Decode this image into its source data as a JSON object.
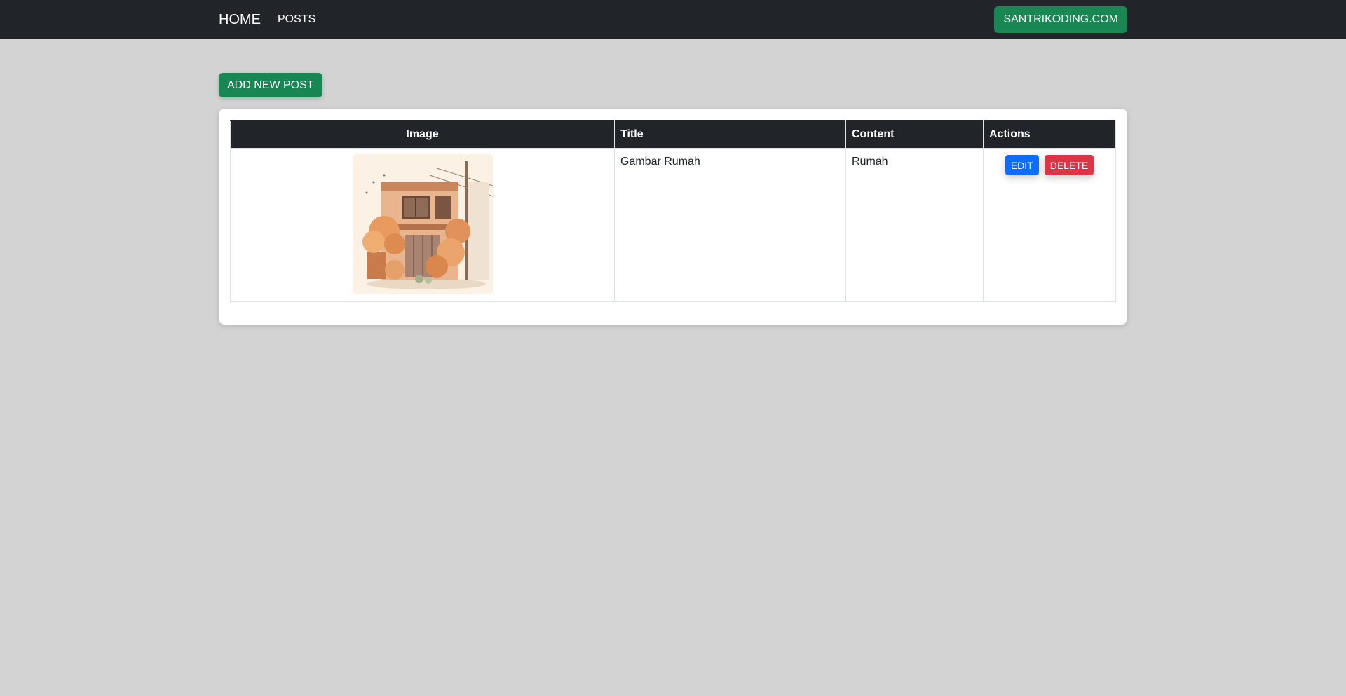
{
  "navbar": {
    "brand": "HOME",
    "links": [
      {
        "label": "POSTS"
      }
    ],
    "site_button": "SANTRIKODING.COM"
  },
  "main": {
    "add_button": "ADD NEW POST",
    "table": {
      "headers": [
        "Image",
        "Title",
        "Content",
        "Actions"
      ],
      "rows": [
        {
          "image_icon": "house-illustration",
          "title": "Gambar Rumah",
          "content": "Rumah",
          "edit_label": "EDIT",
          "delete_label": "DELETE"
        }
      ]
    }
  },
  "colors": {
    "navbar_bg": "#212529",
    "page_bg": "#d3d3d3",
    "success": "#198754",
    "primary": "#0d6efd",
    "danger": "#dc3545"
  }
}
